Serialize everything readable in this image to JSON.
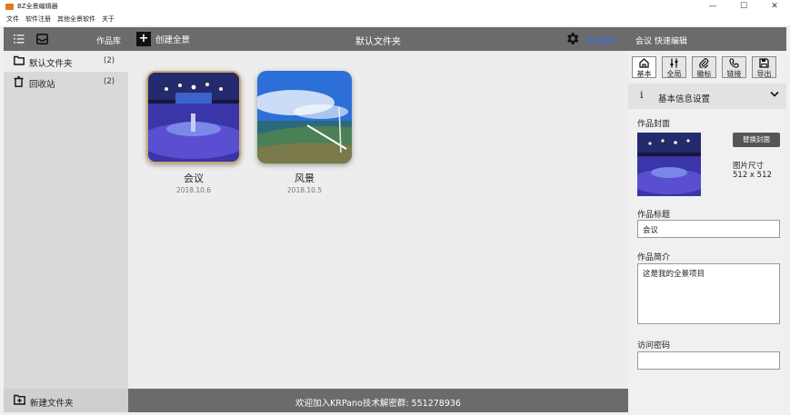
{
  "window": {
    "title": "BZ全景编辑器",
    "controls": {
      "minimize": "—",
      "maximize": "☐",
      "close": "✕"
    }
  },
  "menu": [
    "文件",
    "软件注册",
    "其他全景软件",
    "关于"
  ],
  "left": {
    "library_label": "作品库",
    "folders": [
      {
        "name": "默认文件夹",
        "count": "(2)"
      },
      {
        "name": "回收站",
        "count": "(2)"
      }
    ],
    "new_folder": "新建文件夹"
  },
  "center": {
    "create_label": "创建全景",
    "folder_title": "默认文件夹",
    "register_label": "注册软件",
    "cards": [
      {
        "name": "会议",
        "date": "2018.10.6"
      },
      {
        "name": "风景",
        "date": "2018.10.5"
      }
    ],
    "footer_note": "欢迎加入KRPano技术解密群: 551278936"
  },
  "right": {
    "header_title": "会议 快速编辑",
    "tabs": [
      {
        "label": "基本",
        "icon": "home-icon"
      },
      {
        "label": "全局",
        "icon": "sliders-icon"
      },
      {
        "label": "徽标",
        "icon": "paperclip-icon"
      },
      {
        "label": "链接",
        "icon": "phone-icon"
      },
      {
        "label": "导出",
        "icon": "save-icon"
      }
    ],
    "section_title": "基本信息设置",
    "cover_label": "作品封面",
    "replace_cover": "替换封面",
    "size_label": "图片尺寸",
    "size_value": "512 x 512",
    "title_label": "作品标题",
    "title_value": "会议",
    "intro_label": "作品简介",
    "intro_value": "这是我的全景项目",
    "password_label": "访问密码",
    "password_value": ""
  },
  "colors": {
    "header_gray": "#6b6b6b",
    "register_blue": "#3c6ae0",
    "selected_border": "#c9a96a"
  }
}
